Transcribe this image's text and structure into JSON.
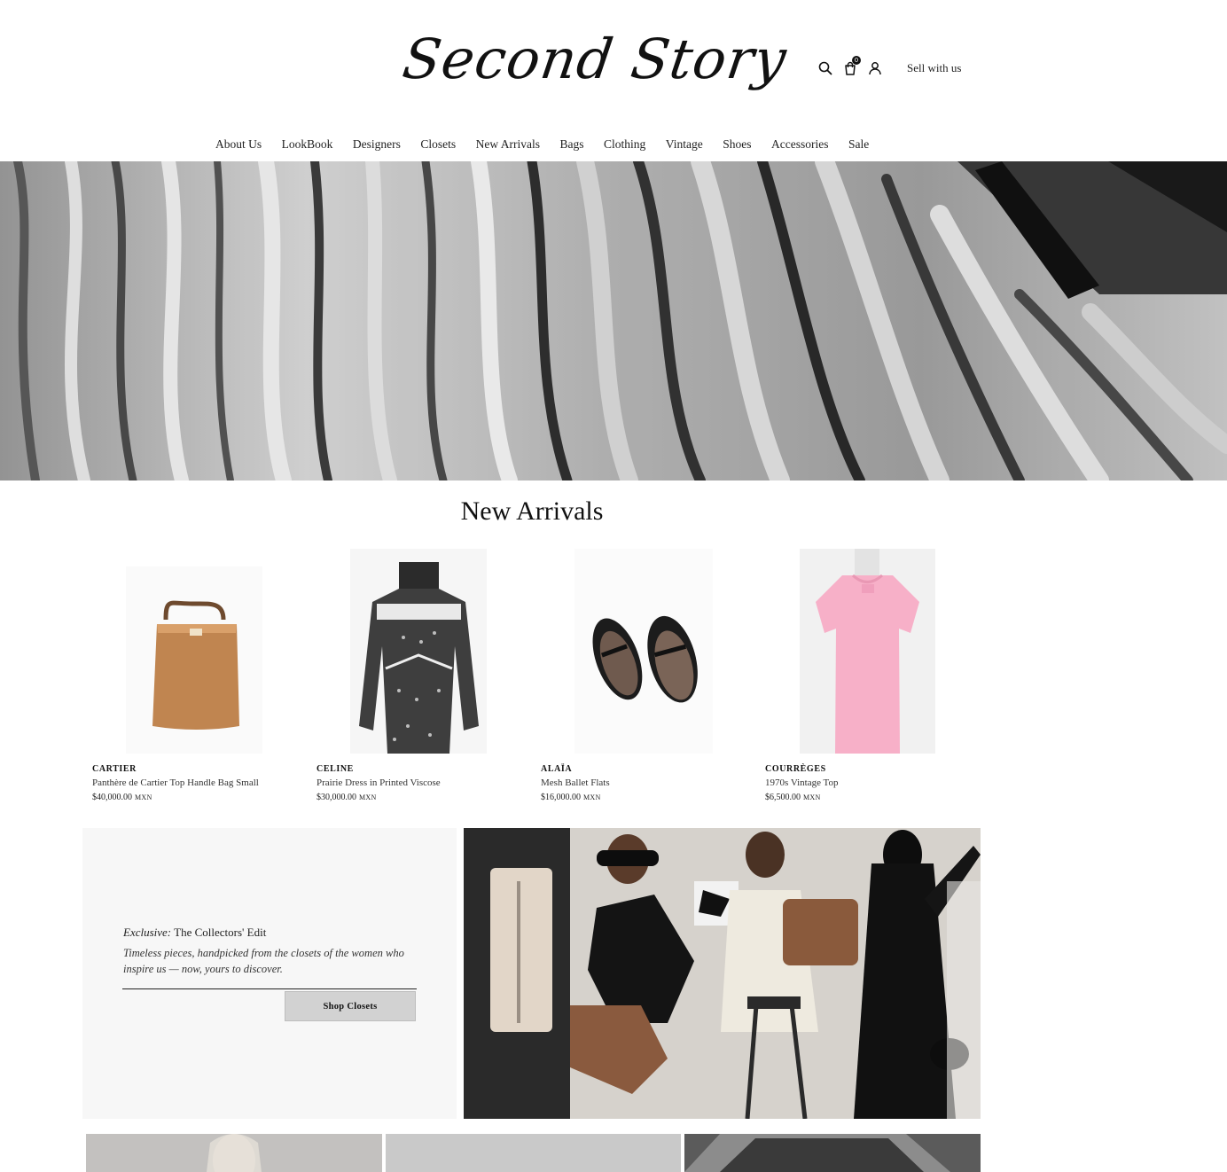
{
  "brand": {
    "logo_text": "Second Story"
  },
  "header": {
    "icons": [
      "search-icon",
      "cart-icon",
      "user-icon"
    ],
    "cart_count": "0",
    "sell_label": "Sell with us"
  },
  "nav": {
    "items": [
      {
        "label": "About Us"
      },
      {
        "label": "LookBook"
      },
      {
        "label": "Designers"
      },
      {
        "label": "Closets"
      },
      {
        "label": "New Arrivals"
      },
      {
        "label": "Bags"
      },
      {
        "label": "Clothing"
      },
      {
        "label": "Vintage"
      },
      {
        "label": "Shoes"
      },
      {
        "label": "Accessories"
      },
      {
        "label": "Sale"
      }
    ]
  },
  "new_arrivals": {
    "title": "New Arrivals",
    "products": [
      {
        "brand": "CARTIER",
        "title": "Panthère de Cartier Top Handle Bag Small",
        "price": "$40,000.00",
        "currency": "MXN"
      },
      {
        "brand": "CELINE",
        "title": "Prairie Dress in Printed Viscose",
        "price": "$30,000.00",
        "currency": "MXN"
      },
      {
        "brand": "ALAÏA",
        "title": "Mesh Ballet Flats",
        "price": "$16,000.00",
        "currency": "MXN"
      },
      {
        "brand": "COURRÈGES",
        "title": "1970s Vintage Top",
        "price": "$6,500.00",
        "currency": "MXN"
      }
    ]
  },
  "editorial": {
    "heading_em": "Exclusive:",
    "heading_rest": " The Collectors' Edit",
    "description": "Timeless pieces, handpicked from the closets of the women who inspire us — now, yours to discover.",
    "button_label": "Shop Closets"
  },
  "colors": {
    "text": "#1a1a1a",
    "panel_bg": "#f7f7f7",
    "button_bg": "#d2d2d2"
  }
}
